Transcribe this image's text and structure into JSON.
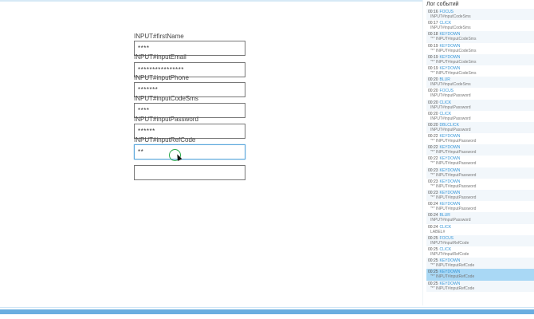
{
  "form": {
    "fields": [
      {
        "label": "INPUT#firstName",
        "value": "****"
      },
      {
        "label": "INPUT#inputEmail",
        "value": "****************"
      },
      {
        "label": "INPUT#inputPhone",
        "value": "*******"
      },
      {
        "label": "INPUT#inputCodeSms",
        "value": "****"
      },
      {
        "label": "INPUT#inputPassword",
        "value": "******"
      },
      {
        "label": "INPUT#inputRefCode",
        "value": "**"
      }
    ],
    "extra_input_value": ""
  },
  "log": {
    "title": "Лог событий",
    "entries": [
      {
        "time": "00:16",
        "type": "FOCUS",
        "target": "INPUT#inputCodeSms"
      },
      {
        "time": "00:17",
        "type": "CLICK",
        "target": "INPUT#inputCodeSms"
      },
      {
        "time": "00:18",
        "type": "KEYDOWN",
        "target": "\"*\" INPUT#inputCodeSms"
      },
      {
        "time": "00:19",
        "type": "KEYDOWN",
        "target": "\"*\" INPUT#inputCodeSms"
      },
      {
        "time": "00:19",
        "type": "KEYDOWN",
        "target": "\"*\" INPUT#inputCodeSms"
      },
      {
        "time": "00:19",
        "type": "KEYDOWN",
        "target": "\"*\" INPUT#inputCodeSms"
      },
      {
        "time": "00:20",
        "type": "BLUR",
        "target": "INPUT#inputCodeSms"
      },
      {
        "time": "00:20",
        "type": "FOCUS",
        "target": "INPUT#inputPassword"
      },
      {
        "time": "00:20",
        "type": "CLICK",
        "target": "INPUT#inputPassword"
      },
      {
        "time": "00:20",
        "type": "CLICK",
        "target": "INPUT#inputPassword"
      },
      {
        "time": "00:20",
        "type": "DBLCLICK",
        "target": "INPUT#inputPassword"
      },
      {
        "time": "00:22",
        "type": "KEYDOWN",
        "target": "\"*\" INPUT#inputPassword"
      },
      {
        "time": "00:22",
        "type": "KEYDOWN",
        "target": "\"*\" INPUT#inputPassword"
      },
      {
        "time": "00:22",
        "type": "KEYDOWN",
        "target": "\"*\" INPUT#inputPassword"
      },
      {
        "time": "00:23",
        "type": "KEYDOWN",
        "target": "\"*\" INPUT#inputPassword"
      },
      {
        "time": "00:23",
        "type": "KEYDOWN",
        "target": "\"*\" INPUT#inputPassword"
      },
      {
        "time": "00:23",
        "type": "KEYDOWN",
        "target": "\"*\" INPUT#inputPassword"
      },
      {
        "time": "00:24",
        "type": "KEYDOWN",
        "target": "\"*\" INPUT#inputPassword"
      },
      {
        "time": "00:24",
        "type": "BLUR",
        "target": "INPUT#inputPassword"
      },
      {
        "time": "00:24",
        "type": "CLICK",
        "target": "LABEL#"
      },
      {
        "time": "00:25",
        "type": "FOCUS",
        "target": "INPUT#inputRefCode"
      },
      {
        "time": "00:25",
        "type": "CLICK",
        "target": "INPUT#inputRefCode"
      },
      {
        "time": "00:25",
        "type": "KEYDOWN",
        "target": "\"*\" INPUT#inputRefCode"
      },
      {
        "time": "00:25",
        "type": "KEYDOWN",
        "target": "\"*\" INPUT#inputRefCode",
        "selected": true
      },
      {
        "time": "00:25",
        "type": "KEYDOWN",
        "target": "\"*\" INPUT#inputRefCode"
      }
    ]
  }
}
